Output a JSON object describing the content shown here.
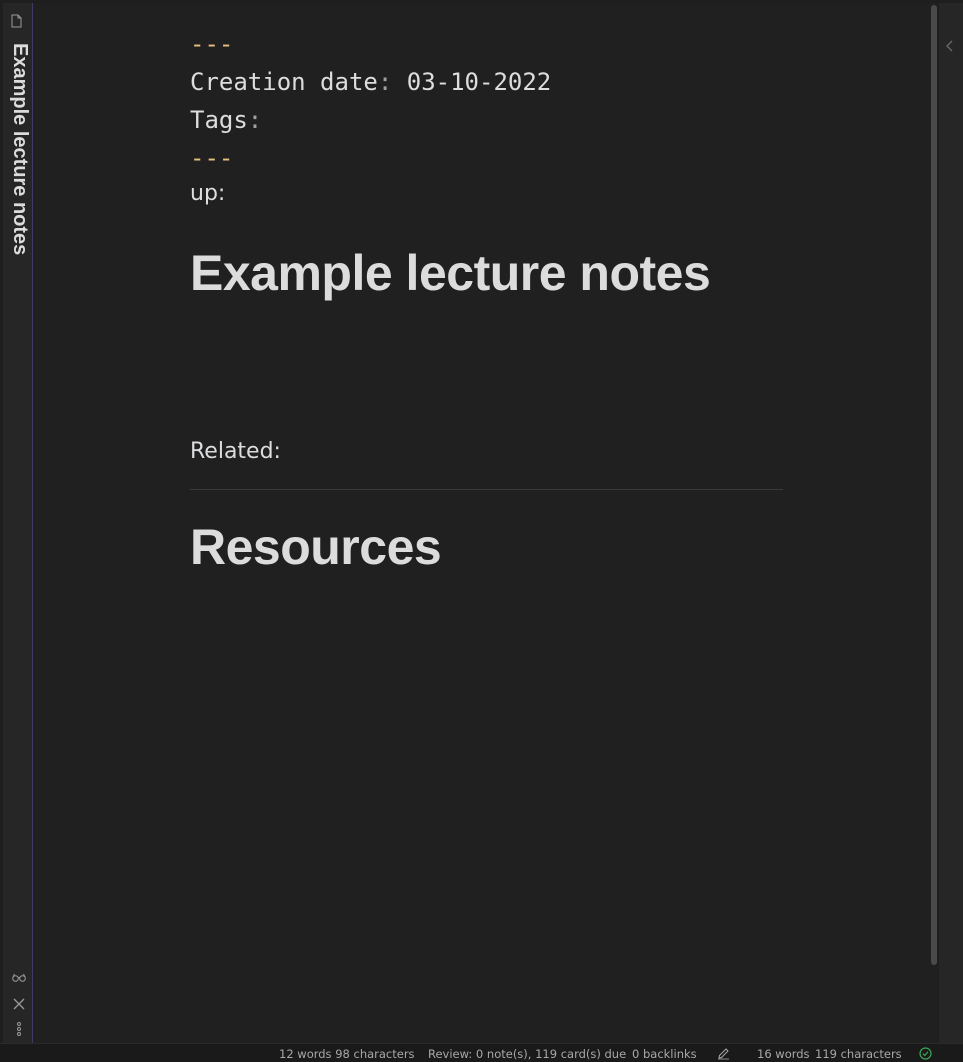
{
  "pane": {
    "tab_title": "Example lecture notes",
    "tab_icon": "file-icon",
    "actions": [
      {
        "icon": "glasses-icon"
      },
      {
        "icon": "close-icon"
      },
      {
        "icon": "more-options-icon"
      }
    ]
  },
  "note": {
    "frontmatter_open": "---",
    "creation_date_key": "Creation date",
    "creation_date_colon": ":",
    "creation_date_value": " 03-10-2022",
    "tags_key": "Tags",
    "tags_colon": ":",
    "frontmatter_close": "---",
    "up_label": "up:",
    "title": "Example lecture notes",
    "related_label": "Related:",
    "resources_heading": "Resources"
  },
  "right_sidebar": {
    "collapse_icon": "chevron-left-icon"
  },
  "status_bar": {
    "selection_count": "12 words 98 characters",
    "review": "Review: 0 note(s), 119 card(s) due",
    "backlinks": "0 backlinks",
    "edit_icon": "pencil-icon",
    "word_count": "16 words",
    "char_count": "119 characters",
    "sync_icon": "sync-check-icon"
  },
  "colors": {
    "background": "#202020",
    "frontmatter_dashes": "#e5c07b",
    "text": "#dcddde",
    "pane_border": "#3f3a68",
    "sync_ok": "#3aa657"
  }
}
